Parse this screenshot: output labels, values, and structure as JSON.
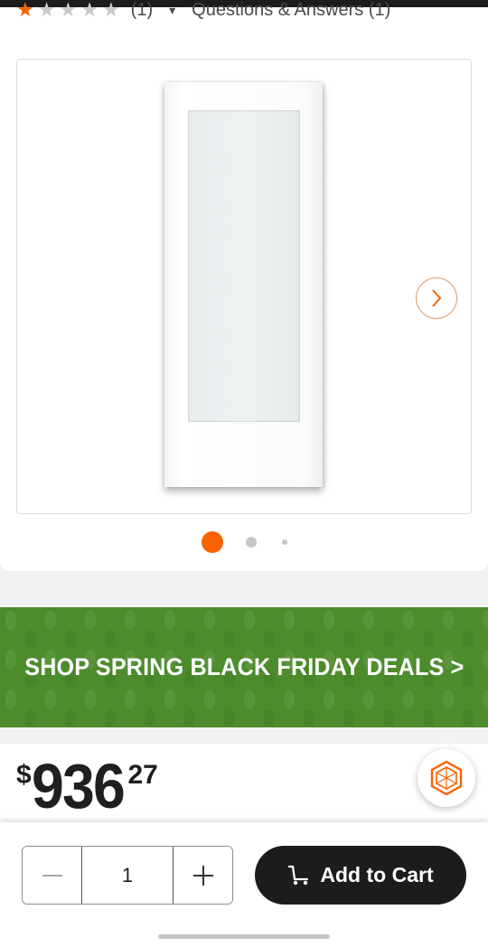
{
  "rating": {
    "stars_filled": 1,
    "stars_total": 5,
    "count_text": "(1)",
    "qa_text": "Questions & Answers (1)"
  },
  "gallery": {
    "image_alt": "White interior door with frosted glass panel",
    "dots_total": 3,
    "active_index": 0
  },
  "promo": {
    "text": "SHOP SPRING BLACK FRIDAY DEALS >"
  },
  "price": {
    "symbol": "$",
    "dollars": "936",
    "cents": "27"
  },
  "cart": {
    "quantity": "1",
    "add_label": "Add to Cart"
  },
  "colors": {
    "accent": "#f96302",
    "promo_green": "#4c8c2c",
    "button_dark": "#1c1c1c"
  }
}
